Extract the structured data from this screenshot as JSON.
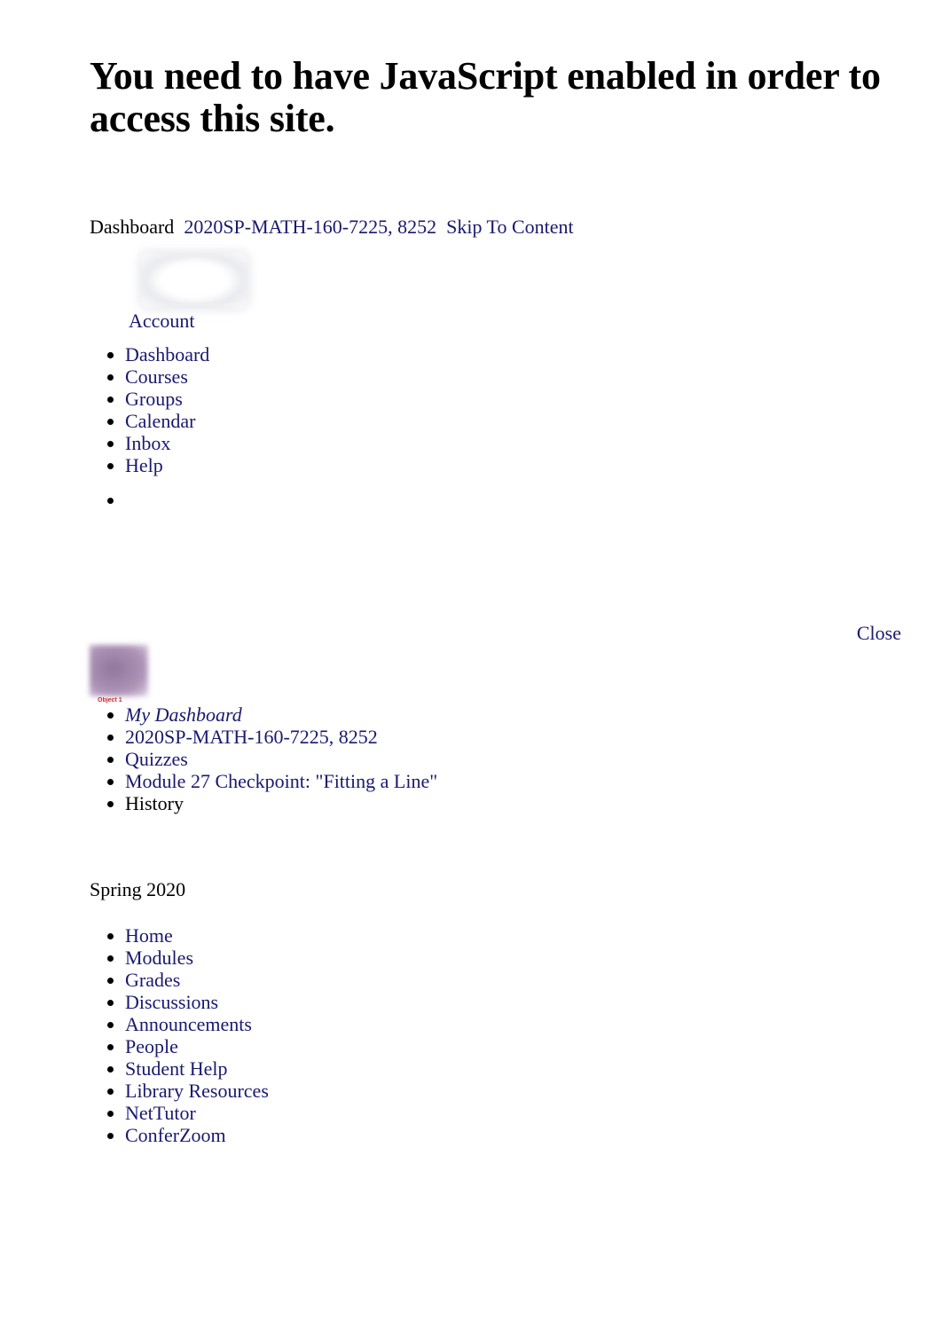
{
  "page": {
    "heading": "You need to have JavaScript enabled in order to access this site."
  },
  "breadcrumb": {
    "current": "Dashboard",
    "course_link": "2020SP-MATH-160-7225, 8252",
    "skip_link": "Skip To Content"
  },
  "global_nav": {
    "account_image_alt": "",
    "items": [
      {
        "label": "Account",
        "type": "link"
      },
      {
        "label": "Dashboard",
        "type": "link"
      },
      {
        "label": "Courses",
        "type": "link"
      },
      {
        "label": "Groups",
        "type": "link"
      },
      {
        "label": "Calendar",
        "type": "link"
      },
      {
        "label": "Inbox",
        "type": "link"
      },
      {
        "label": "Help",
        "type": "link"
      }
    ],
    "empty_item": ""
  },
  "tray": {
    "close_label": "Close"
  },
  "object_figure": {
    "caption": "Object 1"
  },
  "course_crumbs": {
    "items": [
      {
        "label": "My Dashboard",
        "type": "link-italic"
      },
      {
        "label": "2020SP-MATH-160-7225, 8252",
        "type": "link"
      },
      {
        "label": "Quizzes",
        "type": "link"
      },
      {
        "label": "Module 27 Checkpoint: \"Fitting a Line\"",
        "type": "link"
      },
      {
        "label": "History",
        "type": "text"
      }
    ]
  },
  "term": {
    "label": "Spring 2020"
  },
  "course_nav": {
    "items": [
      {
        "label": "Home"
      },
      {
        "label": "Modules"
      },
      {
        "label": "Grades"
      },
      {
        "label": "Discussions"
      },
      {
        "label": "Announcements"
      },
      {
        "label": "People"
      },
      {
        "label": "Student Help"
      },
      {
        "label": "Library Resources"
      },
      {
        "label": "NetTutor"
      },
      {
        "label": "ConferZoom"
      }
    ]
  },
  "colors": {
    "link": "#191970",
    "text": "#000000",
    "caption_red": "#d42a2a",
    "object_purple": "#9a7fa6",
    "background": "#ffffff"
  }
}
